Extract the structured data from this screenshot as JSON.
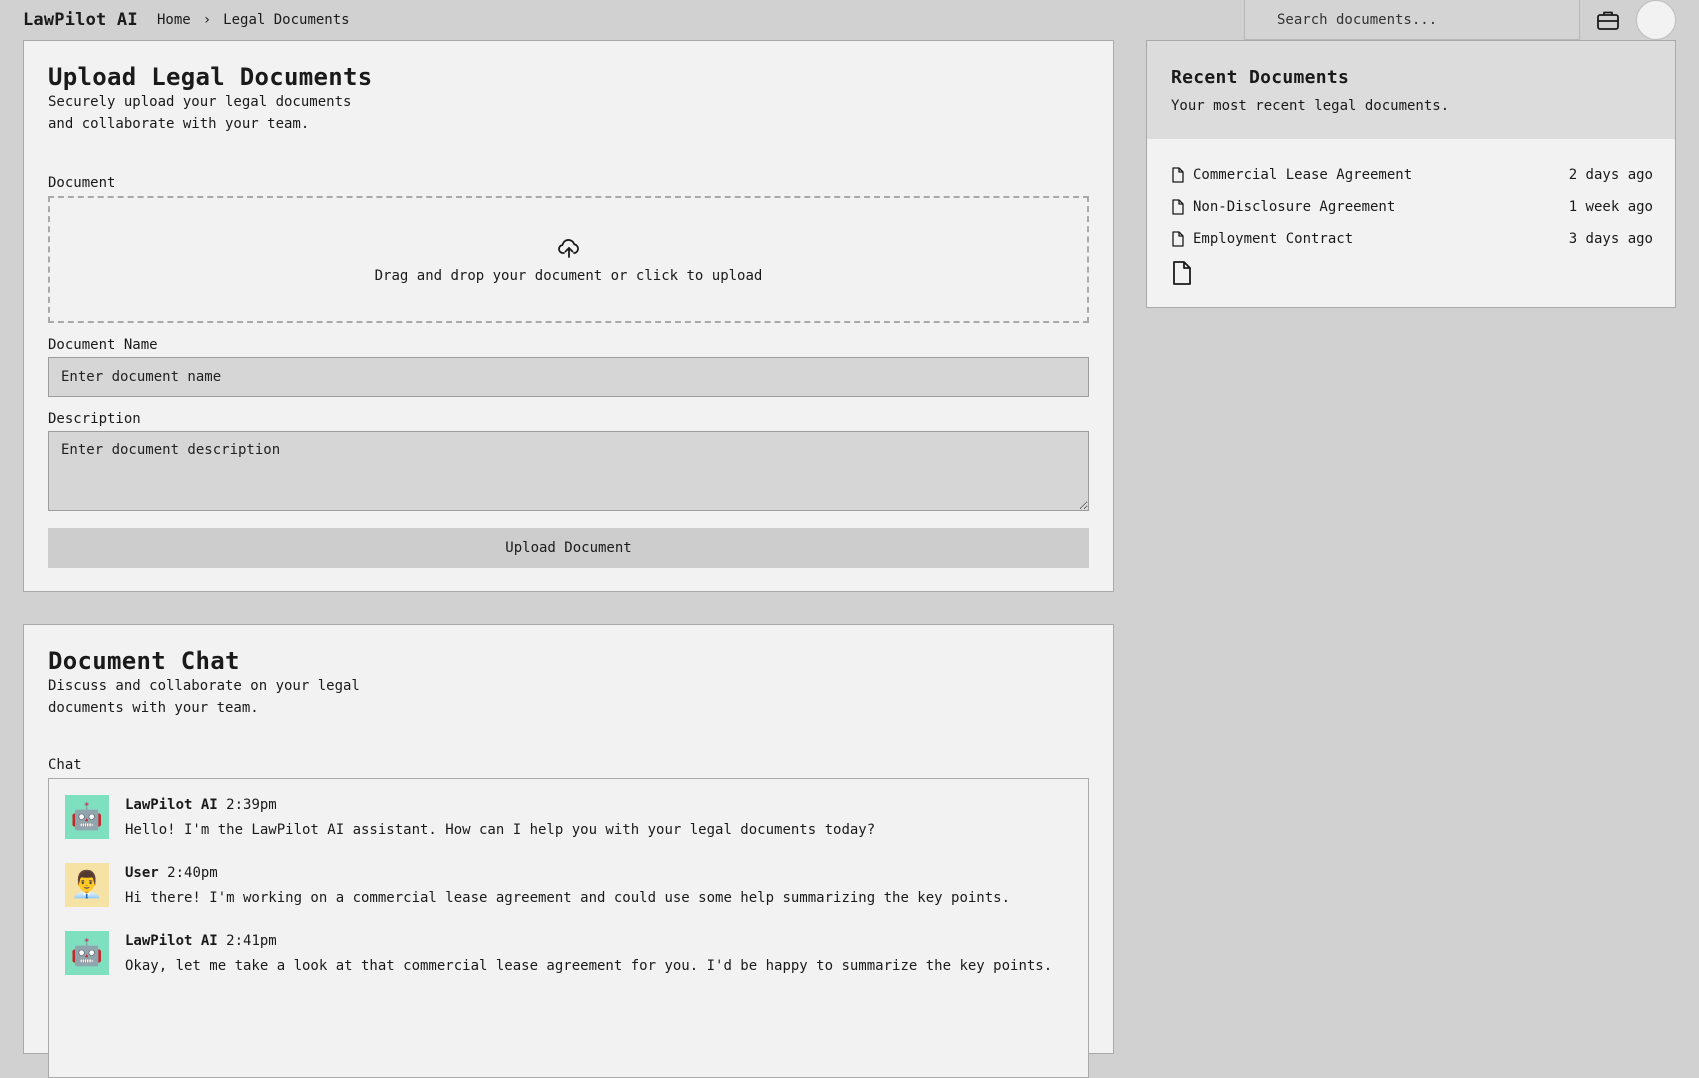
{
  "header": {
    "brand": "LawPilot AI",
    "breadcrumb": [
      "Home",
      "Legal Documents"
    ],
    "breadcrumb_separator": "›",
    "search_placeholder": "Search documents..."
  },
  "upload": {
    "title": "Upload Legal Documents",
    "subtitle": "Securely upload your legal documents and collaborate with your team.",
    "document_label": "Document",
    "dropzone_text": "Drag and drop your document or click to upload",
    "name_label": "Document Name",
    "name_placeholder": "Enter document name",
    "description_label": "Description",
    "description_placeholder": "Enter document description",
    "button_label": "Upload Document"
  },
  "recent": {
    "title": "Recent Documents",
    "subtitle": "Your most recent legal documents.",
    "items": [
      {
        "name": "Commercial Lease Agreement",
        "when": "2 days ago"
      },
      {
        "name": "Non-Disclosure Agreement",
        "when": "1 week ago"
      },
      {
        "name": "Employment Contract",
        "when": "3 days ago"
      }
    ]
  },
  "chat": {
    "title": "Document Chat",
    "subtitle": "Discuss and collaborate on your legal documents with your team.",
    "label": "Chat",
    "messages": [
      {
        "author": "LawPilot AI",
        "time": "2:39pm",
        "avatar": "🤖",
        "text": "Hello! I'm the LawPilot AI assistant. How can I help you with your legal documents today?"
      },
      {
        "author": "User",
        "time": "2:40pm",
        "avatar": "👨‍💼",
        "text": "Hi there! I'm working on a commercial lease agreement and could use some help summarizing the key points."
      },
      {
        "author": "LawPilot AI",
        "time": "2:41pm",
        "avatar": "🤖",
        "text": "Okay, let me take a look at that commercial lease agreement for you. I'd be happy to summarize the key points."
      }
    ]
  },
  "icons": {
    "upload": "cloud-upload-icon",
    "briefcase": "briefcase-icon",
    "file": "file-icon"
  }
}
